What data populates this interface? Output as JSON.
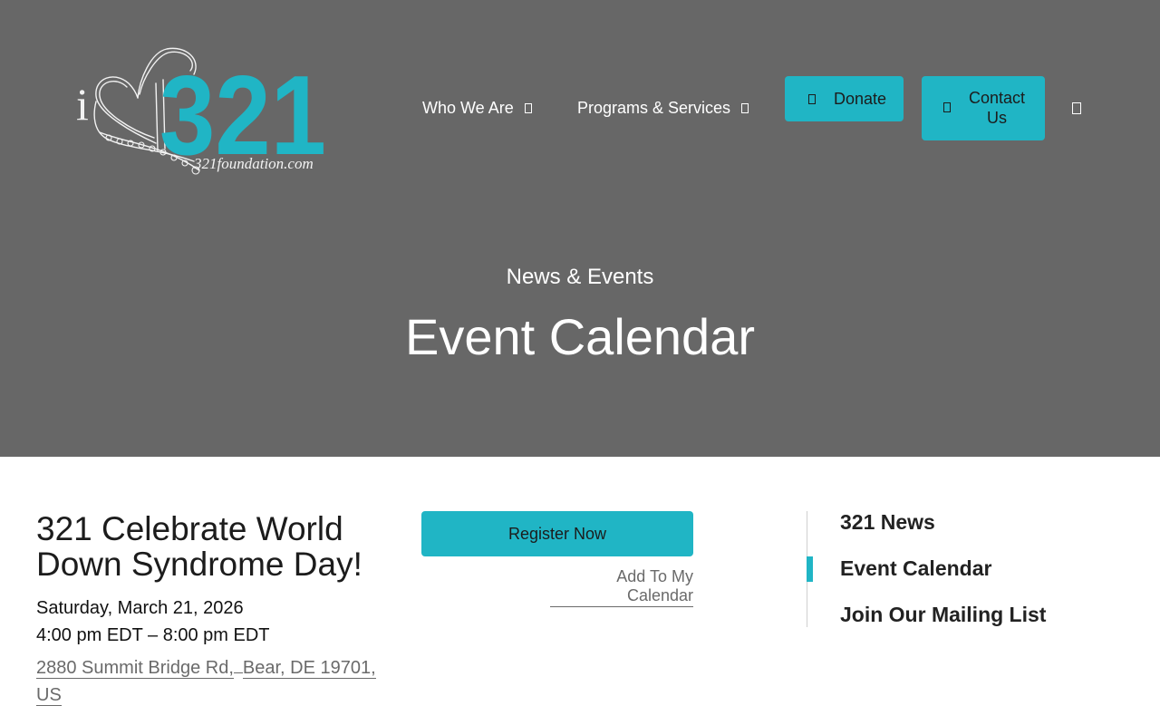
{
  "logo": {
    "letter": "i",
    "number": "321",
    "domain": "321foundation.com"
  },
  "nav": {
    "who_we_are": "Who We Are",
    "programs": "Programs & Services",
    "donate": "Donate",
    "contact": "Contact Us"
  },
  "hero": {
    "subtitle": "News & Events",
    "title": "Event Calendar"
  },
  "event": {
    "title": "321 Celebrate World Down Syndrome Day!",
    "date": "Saturday, March 21, 2026",
    "time": "4:00 pm EDT – 8:00 pm EDT",
    "address_street": "2880 Summit Bridge Rd,",
    "address_city": "Bear, DE 19701,",
    "address_country": "US"
  },
  "actions": {
    "register": "Register Now",
    "add_calendar": "Add To My Calendar"
  },
  "sidebar": {
    "items": [
      {
        "label": "321 News"
      },
      {
        "label": "Event Calendar",
        "active": true
      },
      {
        "label": "Join Our Mailing List"
      }
    ]
  },
  "colors": {
    "hero_bg": "#676767",
    "accent": "#20b5c5",
    "text": "#1c1c1c",
    "link": "#6a6a6a"
  },
  "icons": {
    "nav_dropdown": "chevron-down-icon",
    "donate": "heart-icon",
    "contact": "mail-icon",
    "search": "search-icon"
  }
}
